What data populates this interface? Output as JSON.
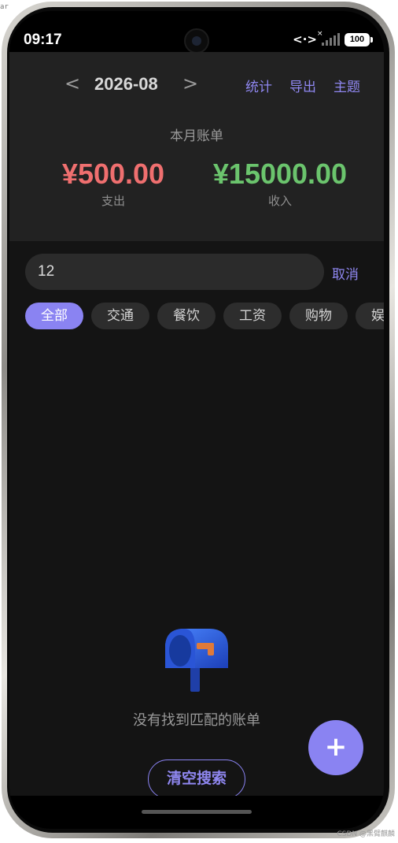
{
  "status_bar": {
    "time": "09:17",
    "code_icon": "<·>",
    "signal_icon": "signal-icon",
    "battery": "100"
  },
  "header": {
    "prev_label": "<",
    "month": "2026-08",
    "next_label": ">",
    "actions": [
      "统计",
      "导出",
      "主题"
    ],
    "summary_title": "本月账单",
    "expense": {
      "amount": "¥500.00",
      "label": "支出"
    },
    "income": {
      "amount": "¥15000.00",
      "label": "收入"
    }
  },
  "search": {
    "value": "12",
    "cancel_label": "取消"
  },
  "categories": {
    "items": [
      "全部",
      "交通",
      "餐饮",
      "工资",
      "购物",
      "娱"
    ],
    "selected": "全部"
  },
  "empty_state": {
    "icon": "mailbox-icon",
    "message": "没有找到匹配的账单",
    "clear_label": "清空搜索"
  },
  "fab": {
    "label": "+"
  },
  "watermark": "CSDN @黑臂麒麟",
  "corner_text": "ar",
  "colors": {
    "accent": "#8a83f2",
    "expense": "#ef6f6f",
    "income": "#6bc46d",
    "background": "#141414",
    "header": "#222222"
  }
}
